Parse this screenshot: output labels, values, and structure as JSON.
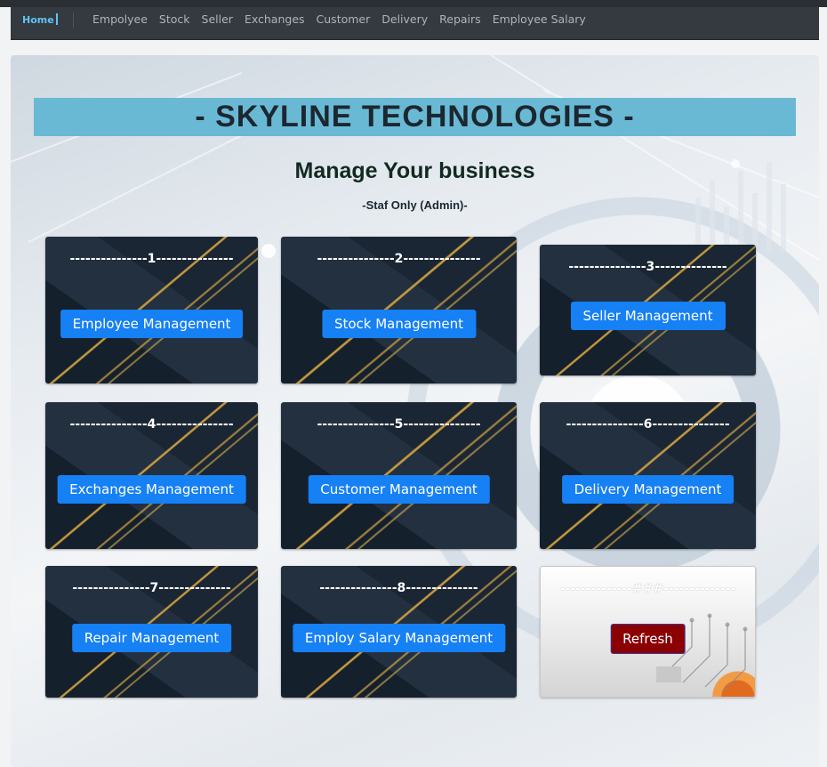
{
  "navbar": {
    "home_label": "Home",
    "links": [
      "Empolyee",
      "Stock",
      "Seller",
      "Exchanges",
      "Customer",
      "Delivery",
      "Repairs",
      "Employee Salary"
    ]
  },
  "header": {
    "title": "- SKYLINE TECHNOLOGIES -",
    "subtitle": "Manage Your business",
    "staff_note": "-Staf Only (Admin)-"
  },
  "cards": [
    {
      "number_line": "---------------1---------------",
      "button": "Employee Management"
    },
    {
      "number_line": "---------------2---------------",
      "button": "Stock Management"
    },
    {
      "number_line": "---------------3--------------",
      "button": "Seller Management"
    },
    {
      "number_line": "---------------4---------------",
      "button": "Exchanges Management"
    },
    {
      "number_line": "---------------5---------------",
      "button": "Customer Management"
    },
    {
      "number_line": "---------------6---------------",
      "button": "Delivery Management"
    },
    {
      "number_line": "---------------7--------------",
      "button": "Repair Management"
    },
    {
      "number_line": "---------------8--------------",
      "button": "Employ Salary Management"
    }
  ],
  "refresh_card": {
    "number_line": "--------------###--------------",
    "button": "Refresh"
  }
}
